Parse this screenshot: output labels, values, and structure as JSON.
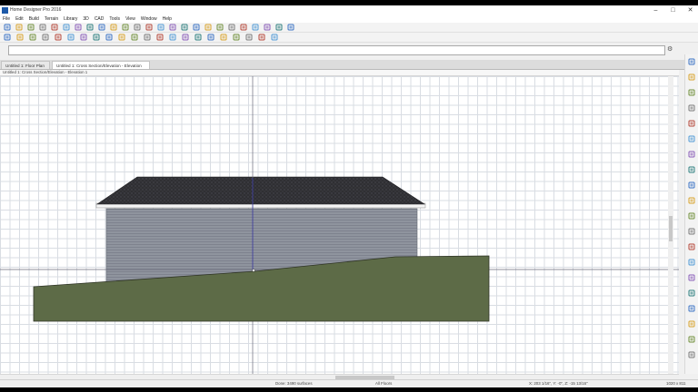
{
  "window": {
    "title": "Home Designer Pro 2016"
  },
  "menu": [
    "File",
    "Edit",
    "Build",
    "Terrain",
    "Library",
    "3D",
    "CAD",
    "Tools",
    "View",
    "Window",
    "Help"
  ],
  "tabs": [
    {
      "label": "Untitled 1: Floor Plan",
      "active": false
    },
    {
      "label": "Untitled 1: Cross Section/Elevation - Elevation 1",
      "active": true
    }
  ],
  "view_title": "Untitled 1: Cross Section/Elevation - Elevation 1",
  "status": {
    "message": "Done: 3490 surfaces",
    "floors": "All Floors",
    "coords": "X: 203 1/16\", Y: -0\", Z: -15 13/16\"",
    "size": "1020 x 811"
  },
  "colors": {
    "roof": "#2f2f33",
    "siding": "#8f949e",
    "terrain": "#5d6b47",
    "accent": "#1e5aa8"
  },
  "icons": {
    "toolbar1": [
      "new-icon",
      "open-icon",
      "save-icon",
      "print-icon",
      "print-preview-icon",
      "undo-icon",
      "redo-icon",
      "select-icon",
      "layers-icon",
      "help-icon",
      "house-icon",
      "camera-icon",
      "floor-camera-icon",
      "elevation-icon",
      "cross-section-icon",
      "wall-icon",
      "door-icon",
      "window-icon",
      "stairs-icon",
      "dimension-icon",
      "lock-icon",
      "tool-icon",
      "zoom-view-icon",
      "plan-view-icon",
      "fill-window-icon"
    ],
    "toolbar2": [
      "select-objects-icon",
      "edit-icon",
      "delete-icon",
      "copy-icon",
      "move-icon",
      "mirror-icon",
      "stretch-icon",
      "transform-icon",
      "group-icon",
      "align-icon",
      "cabinet-icon",
      "fixture-icon",
      "furniture-icon",
      "roof-icon",
      "terrain-icon",
      "pencil-icon",
      "text-icon",
      "line-icon",
      "arc-icon",
      "circle-icon",
      "polyline-icon",
      "spline-icon"
    ],
    "side": [
      "zoom-in-icon",
      "zoom-out-icon",
      "zoom-fit-icon",
      "pan-icon",
      "undo-zoom-icon",
      "fill-window-icon",
      "plan-icon",
      "camera-icon",
      "layer-icon",
      "symbol-icon",
      "dimension-icon",
      "text-icon",
      "material-icon",
      "lightbulb-icon",
      "render-icon",
      "grid-icon",
      "snap-icon",
      "settings-icon",
      "floor-up-icon",
      "floor-down-icon"
    ]
  }
}
